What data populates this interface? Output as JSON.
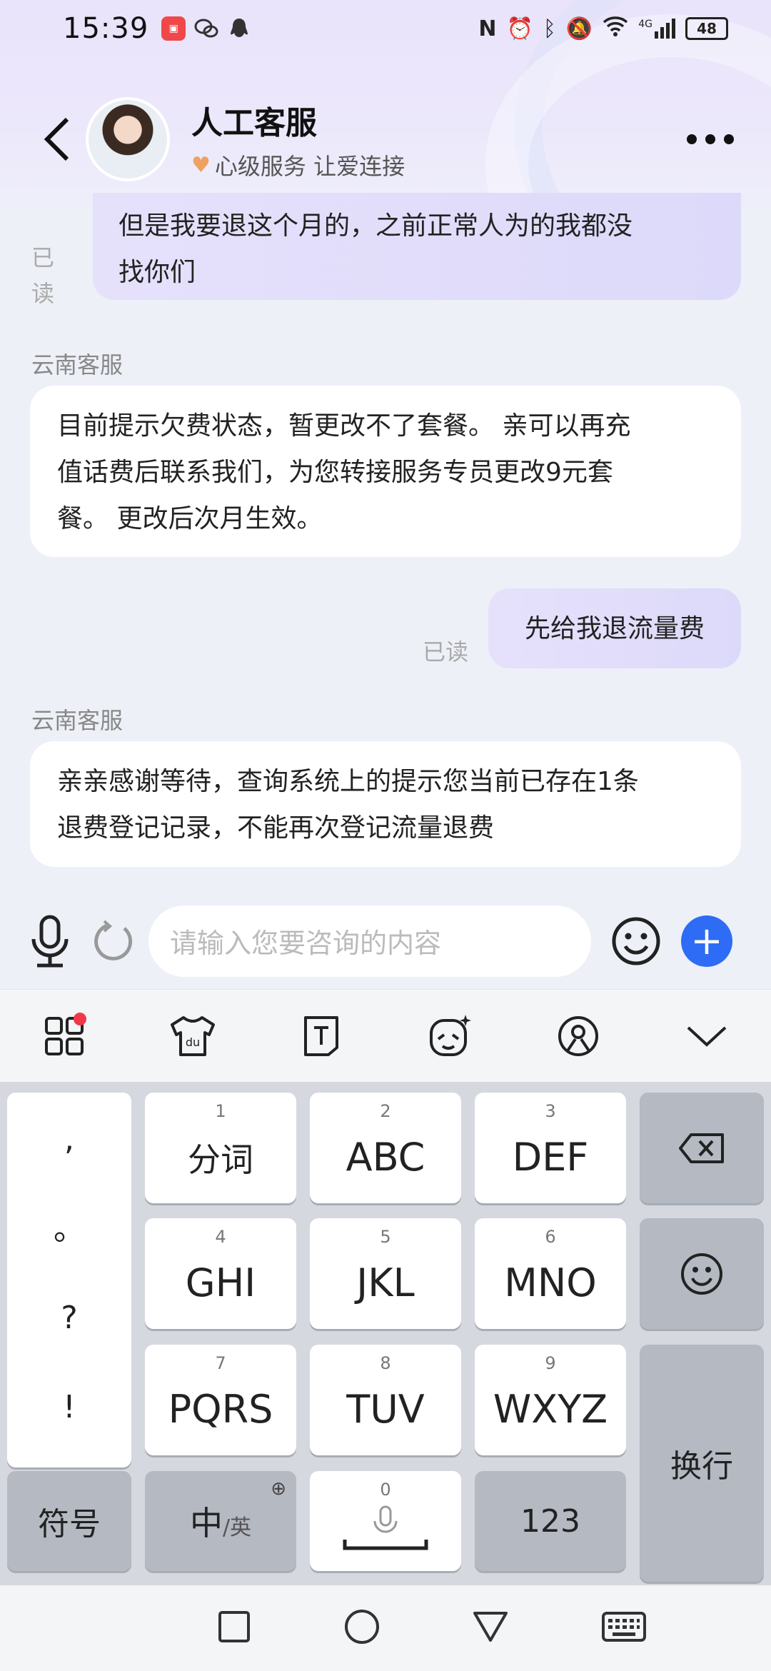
{
  "status_bar": {
    "time": "15:39",
    "network": "4G",
    "battery": "48"
  },
  "header": {
    "title": "人工客服",
    "subtitle": "心级服务 让爱连接"
  },
  "messages": {
    "m1": {
      "text_line1": "但是我要退这个月的，之前正常人为的我都没",
      "text_line2": "找你们",
      "read": "已读"
    },
    "m2": {
      "sender": "云南客服",
      "line1": "目前提示欠费状态，暂更改不了套餐。 亲可以再充",
      "line2": "值话费后联系我们，为您转接服务专员更改9元套",
      "line3": "餐。 更改后次月生效。"
    },
    "m3": {
      "text": "先给我退流量费",
      "read": "已读"
    },
    "m4": {
      "sender": "云南客服",
      "line1": "亲亲感谢等待，查询系统上的提示您当前已存在1条",
      "line2": "退费登记记录，不能再次登记流量退费"
    }
  },
  "input": {
    "placeholder": "请输入您要咨询的内容",
    "plus_label": "+"
  },
  "keyboard": {
    "punct": [
      ",",
      "。",
      "?",
      "!"
    ],
    "keys": [
      {
        "num": "1",
        "label": "分词"
      },
      {
        "num": "2",
        "label": "ABC"
      },
      {
        "num": "3",
        "label": "DEF"
      },
      {
        "num": "4",
        "label": "GHI"
      },
      {
        "num": "5",
        "label": "JKL"
      },
      {
        "num": "6",
        "label": "MNO"
      },
      {
        "num": "7",
        "label": "PQRS"
      },
      {
        "num": "8",
        "label": "TUV"
      },
      {
        "num": "9",
        "label": "WXYZ"
      }
    ],
    "symbols": "符号",
    "lang_main": "中",
    "lang_sub": "/英",
    "space_num": "0",
    "num_key": "123",
    "enter": "换行"
  },
  "colors": {
    "accent": "#2e6cf6",
    "my_bubble": "#e2defa",
    "notif_dot": "#f0384a"
  }
}
